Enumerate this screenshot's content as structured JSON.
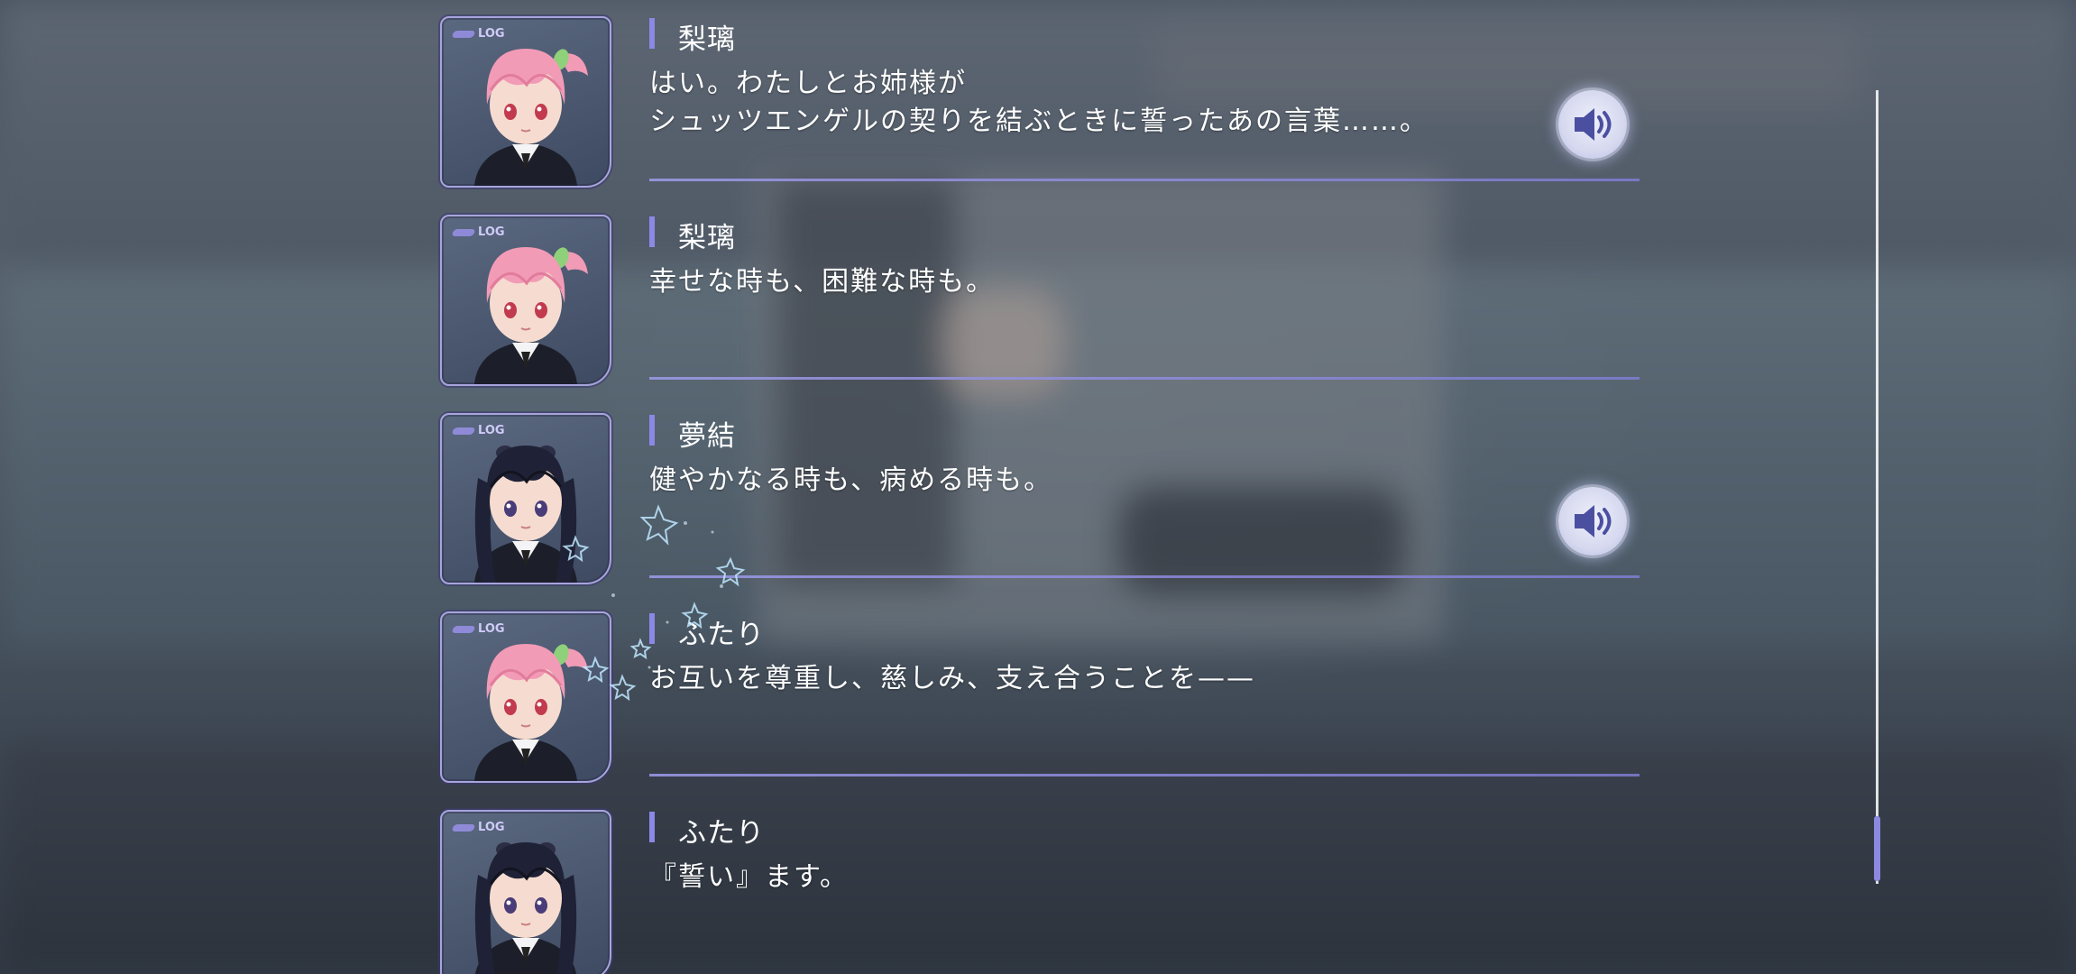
{
  "log": {
    "tag_label": "LOG",
    "entries": [
      {
        "speaker": "梨璃",
        "text": "はい。わたしとお姉様が\nシュッツエンゲルの契りを結ぶときに誓ったあの言葉……。",
        "character": "riri",
        "has_voice": true
      },
      {
        "speaker": "梨璃",
        "text": "幸せな時も、困難な時も。",
        "character": "riri",
        "has_voice": false
      },
      {
        "speaker": "夢結",
        "text": "健やかなる時も、病める時も。",
        "character": "yuyu",
        "has_voice": true
      },
      {
        "speaker": "ふたり",
        "text": "お互いを尊重し、慈しみ、支え合うことを——",
        "character": "riri",
        "has_voice": false
      },
      {
        "speaker": "ふたり",
        "text": "『誓い』ます。",
        "character": "yuyu",
        "has_voice": false
      }
    ]
  },
  "icons": {
    "voice": "speaker-volume-icon",
    "tag": "log-tag-icon"
  },
  "colors": {
    "accent": "#8b88e6",
    "divider": "#9e9bea",
    "text": "#ffffff",
    "portrait_frame": "#a7a4dc",
    "riri_hair": "#f29bb6",
    "yuyu_hair": "#1f2236"
  },
  "scroll": {
    "position": 0.92
  }
}
